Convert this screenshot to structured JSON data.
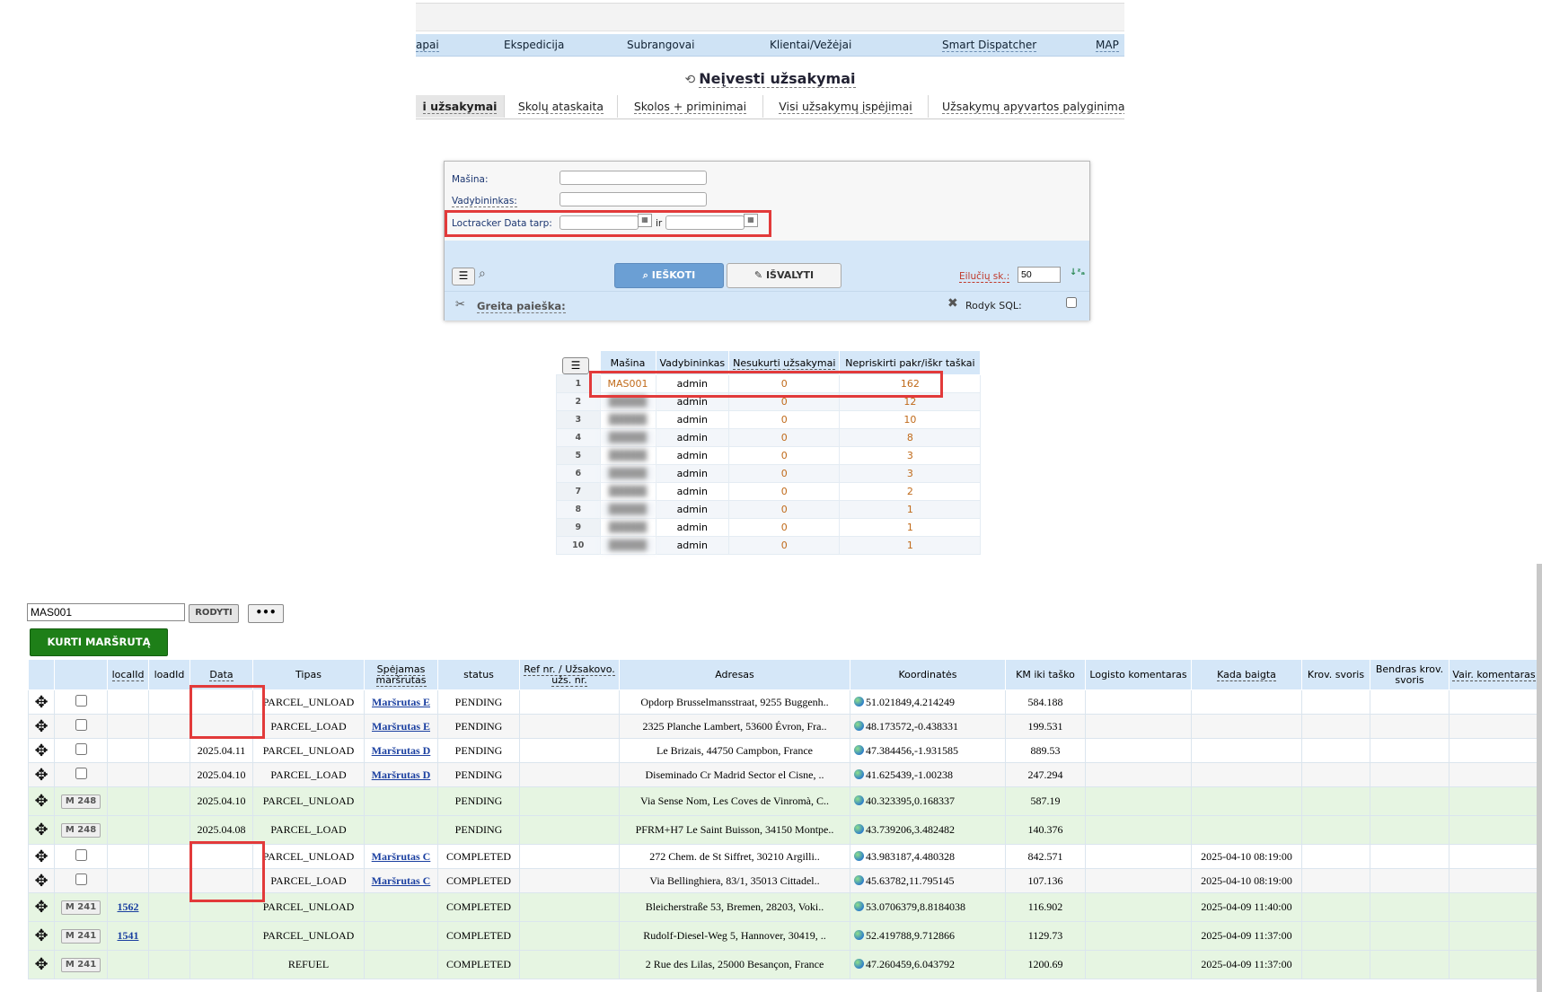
{
  "nav": {
    "items": [
      "apai",
      "Ekspedicija",
      "Subrangovai",
      "Klientai/Vežėjai",
      "Smart Dispatcher",
      "MAP"
    ]
  },
  "page": {
    "title": "Neįvesti užsakymai",
    "title_icon": "history-icon"
  },
  "tabs": [
    "i užsakymai",
    "Skolų ataskaita",
    "Skolos + priminimai",
    "Visi užsakymų įspėjimai",
    "Užsakymų apyvartos palyginimas"
  ],
  "filter": {
    "machine_label": "Mašina:",
    "manager_label": "Vadybininkas:",
    "date_label": "Loctracker Data tarp:",
    "date_and": "ir",
    "search_button": "IEŠKOTI",
    "clear_button": "IŠVALYTI",
    "rows_label": "Eilučių sk.:",
    "rows_value": "50",
    "quick_search": "Greita paieška:",
    "show_sql": "Rodyk SQL:"
  },
  "summary": {
    "headers": [
      "Mašina",
      "Vadybininkas",
      "Nesukurti užsakymai",
      "Nepriskirti pakr/iškr taškai"
    ],
    "rows": [
      {
        "n": "1",
        "machine": "MAS001",
        "manager": "admin",
        "uncreated": "0",
        "unassigned": "162"
      },
      {
        "n": "2",
        "machine": "",
        "manager": "admin",
        "uncreated": "0",
        "unassigned": "12"
      },
      {
        "n": "3",
        "machine": "",
        "manager": "admin",
        "uncreated": "0",
        "unassigned": "10"
      },
      {
        "n": "4",
        "machine": "",
        "manager": "admin",
        "uncreated": "0",
        "unassigned": "8"
      },
      {
        "n": "5",
        "machine": "",
        "manager": "admin",
        "uncreated": "0",
        "unassigned": "3"
      },
      {
        "n": "6",
        "machine": "",
        "manager": "admin",
        "uncreated": "0",
        "unassigned": "3"
      },
      {
        "n": "7",
        "machine": "",
        "manager": "admin",
        "uncreated": "0",
        "unassigned": "2"
      },
      {
        "n": "8",
        "machine": "",
        "manager": "admin",
        "uncreated": "0",
        "unassigned": "1"
      },
      {
        "n": "9",
        "machine": "",
        "manager": "admin",
        "uncreated": "0",
        "unassigned": "1"
      },
      {
        "n": "10",
        "machine": "",
        "manager": "admin",
        "uncreated": "0",
        "unassigned": "1"
      }
    ]
  },
  "controls": {
    "machine_value": "MAS001",
    "show_button": "RODYTI",
    "more_button": "•••",
    "create_route_button": "KURTI MARŠRUTĄ"
  },
  "main": {
    "headers": [
      "",
      "",
      "localId",
      "loadId",
      "Data",
      "Tipas",
      "Spėjamas maršrutas",
      "status",
      "Ref nr. / Užsakovo. užs. nr.",
      "Adresas",
      "Koordinatės",
      "KM iki taško",
      "Logisto komentaras",
      "Kada baigta",
      "Krov. svoris",
      "Bendras krov. svoris",
      "Vair. komentaras"
    ],
    "rows": [
      {
        "style": "w",
        "sel": "checkbox",
        "badge": "",
        "localId": "",
        "date": "",
        "type": "PARCEL_UNLOAD",
        "route": "Maršrutas E",
        "status": "PENDING",
        "address": "Opdorp Brusselmansstraat, 9255 Buggenh..",
        "coords": "51.021849,4.214249",
        "km": "584.188",
        "done": ""
      },
      {
        "style": "w2",
        "sel": "checkbox",
        "badge": "",
        "localId": "",
        "date": "",
        "type": "PARCEL_LOAD",
        "route": "Maršrutas E",
        "status": "PENDING",
        "address": "2325 Planche Lambert, 53600 Évron, Fra..",
        "coords": "48.173572,-0.438331",
        "km": "199.531",
        "done": ""
      },
      {
        "style": "w",
        "sel": "checkbox",
        "badge": "",
        "localId": "",
        "date": "2025.04.11",
        "type": "PARCEL_UNLOAD",
        "route": "Maršrutas D",
        "status": "PENDING",
        "address": "Le Brizais, 44750 Campbon, France",
        "coords": "47.384456,-1.931585",
        "km": "889.53",
        "done": ""
      },
      {
        "style": "w2",
        "sel": "checkbox",
        "badge": "",
        "localId": "",
        "date": "2025.04.10",
        "type": "PARCEL_LOAD",
        "route": "Maršrutas D",
        "status": "PENDING",
        "address": "Diseminado Cr Madrid Sector el Cisne, ..",
        "coords": "41.625439,-1.00238",
        "km": "247.294",
        "done": ""
      },
      {
        "style": "g",
        "sel": "badge",
        "badge": "M 248",
        "localId": "",
        "date": "2025.04.10",
        "type": "PARCEL_UNLOAD",
        "route": "",
        "status": "PENDING",
        "address": "Via Sense Nom, Les Coves de Vinromà, C..",
        "coords": "40.323395,0.168337",
        "km": "587.19",
        "done": ""
      },
      {
        "style": "g",
        "sel": "badge",
        "badge": "M 248",
        "localId": "",
        "date": "2025.04.08",
        "type": "PARCEL_LOAD",
        "route": "",
        "status": "PENDING",
        "address": "PFRM+H7 Le Saint Buisson, 34150 Montpe..",
        "coords": "43.739206,3.482482",
        "km": "140.376",
        "done": ""
      },
      {
        "style": "w",
        "sel": "checkbox",
        "badge": "",
        "localId": "",
        "date": "",
        "type": "PARCEL_UNLOAD",
        "route": "Maršrutas C",
        "status": "COMPLETED",
        "address": "272 Chem. de St Siffret, 30210 Argilli..",
        "coords": "43.983187,4.480328",
        "km": "842.571",
        "done": "2025-04-10 08:19:00"
      },
      {
        "style": "w2",
        "sel": "checkbox",
        "badge": "",
        "localId": "",
        "date": "",
        "type": "PARCEL_LOAD",
        "route": "Maršrutas C",
        "status": "COMPLETED",
        "address": "Via Bellinghiera, 83/1, 35013 Cittadel..",
        "coords": "45.63782,11.795145",
        "km": "107.136",
        "done": "2025-04-10 08:19:00"
      },
      {
        "style": "g",
        "sel": "badge",
        "badge": "M 241",
        "localId": "1562",
        "date": "",
        "type": "PARCEL_UNLOAD",
        "route": "",
        "status": "COMPLETED",
        "address": "Bleicherstraße 53, Bremen, 28203, Voki..",
        "coords": "53.0706379,8.8184038",
        "km": "116.902",
        "done": "2025-04-09 11:40:00"
      },
      {
        "style": "g",
        "sel": "badge",
        "badge": "M 241",
        "localId": "1541",
        "date": "",
        "type": "PARCEL_UNLOAD",
        "route": "",
        "status": "COMPLETED",
        "address": "Rudolf-Diesel-Weg 5, Hannover, 30419, ..",
        "coords": "52.419788,9.712866",
        "km": "1129.73",
        "done": "2025-04-09 11:37:00"
      },
      {
        "style": "g",
        "sel": "badge",
        "badge": "M 241",
        "localId": "",
        "date": "",
        "type": "REFUEL",
        "route": "",
        "status": "COMPLETED",
        "address": "2 Rue des Lilas, 25000 Besançon, France",
        "coords": "47.260459,6.043792",
        "km": "1200.69",
        "done": "2025-04-09 11:37:00"
      }
    ]
  },
  "colors": {
    "accent_blue": "#d5e7f8",
    "green_button": "#1e7f18",
    "highlight_red": "#e23a3a",
    "orange_text": "#c06a1a"
  }
}
